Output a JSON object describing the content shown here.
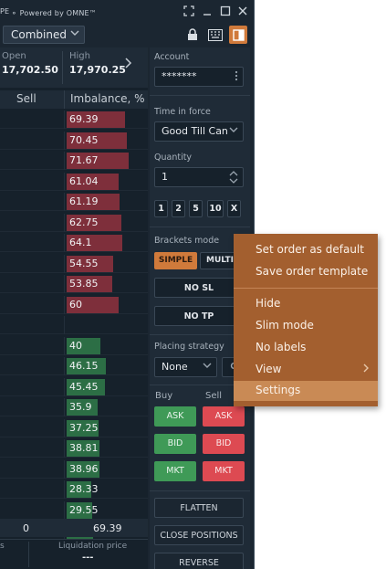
{
  "window": {
    "brand_prefix": "PE",
    "brand_text": "⚬ Powered by OMNE™",
    "view_select": "Combined"
  },
  "stats": {
    "open_label": "Open",
    "open_value": "17,702.50",
    "high_label": "High",
    "high_value": "17,970.25"
  },
  "grid": {
    "col_sell": "Sell",
    "col_imbalance": "Imbalance, %",
    "rows": [
      {
        "value": "69.39",
        "color": "red",
        "fill": 0.92
      },
      {
        "value": "70.45",
        "color": "red",
        "fill": 0.94
      },
      {
        "value": "71.67",
        "color": "red",
        "fill": 0.97
      },
      {
        "value": "61.04",
        "color": "red",
        "fill": 0.82
      },
      {
        "value": "61.19",
        "color": "red",
        "fill": 0.83
      },
      {
        "value": "62.75",
        "color": "red",
        "fill": 0.86
      },
      {
        "value": "64.1",
        "color": "red",
        "fill": 0.87
      },
      {
        "value": "54.55",
        "color": "red",
        "fill": 0.73
      },
      {
        "value": "53.85",
        "color": "red",
        "fill": 0.72
      },
      {
        "value": "60",
        "color": "red",
        "fill": 0.81
      },
      {
        "value": "",
        "color": "none",
        "fill": 0
      },
      {
        "value": "40",
        "color": "green",
        "fill": 0.53
      },
      {
        "value": "46.15",
        "color": "green",
        "fill": 0.61
      },
      {
        "value": "45.45",
        "color": "green",
        "fill": 0.6
      },
      {
        "value": "35.9",
        "color": "green",
        "fill": 0.48
      },
      {
        "value": "37.25",
        "color": "green",
        "fill": 0.5
      },
      {
        "value": "38.81",
        "color": "green",
        "fill": 0.52
      },
      {
        "value": "38.96",
        "color": "green",
        "fill": 0.52
      },
      {
        "value": "28.33",
        "color": "green",
        "fill": 0.38
      },
      {
        "value": "29.55",
        "color": "green",
        "fill": 0.4
      },
      {
        "value": "30.61",
        "color": "green",
        "fill": 0.41
      }
    ],
    "total_sell": "0",
    "total_imbalance": "69.39",
    "footer_left_label": "s",
    "footer_liq_label": "Liquidation price",
    "footer_liq_value": "---"
  },
  "side": {
    "account_label": "Account",
    "account_value": "*******",
    "tif_label": "Time in force",
    "tif_value": "Good Till Can",
    "qty_label": "Quantity",
    "qty_value": "1",
    "qty_presets": [
      "1",
      "2",
      "5",
      "10",
      "X"
    ],
    "brackets_label": "Brackets mode",
    "simple_label": "SIMPLE",
    "multi_label": "MULTI",
    "no_sl_label": "NO SL",
    "no_tp_label": "NO TP",
    "placing_label": "Placing strategy",
    "placing_value": "None",
    "buy_label": "Buy",
    "sell_label": "Sell",
    "ask_label": "ASK",
    "bid_label": "BID",
    "mkt_label": "MKT",
    "flatten_label": "FLATTEN",
    "close_positions_label": "CLOSE POSITIONS",
    "reverse_label": "REVERSE"
  },
  "menu": {
    "items": [
      {
        "label": "Set order as default"
      },
      {
        "label": "Save order template"
      },
      {
        "label": "Hide"
      },
      {
        "label": "Slim mode"
      },
      {
        "label": "No labels"
      },
      {
        "label": "View"
      },
      {
        "label": "Settings"
      }
    ]
  },
  "colors": {
    "accent": "#d07a3b",
    "menu_bg": "#a35f2f",
    "menu_highlight": "#c98a55",
    "sell_bar": "#7e2f3b",
    "buy_bar": "#2c6e45",
    "buy_button": "#3f9a57",
    "sell_button": "#dd4a52"
  }
}
